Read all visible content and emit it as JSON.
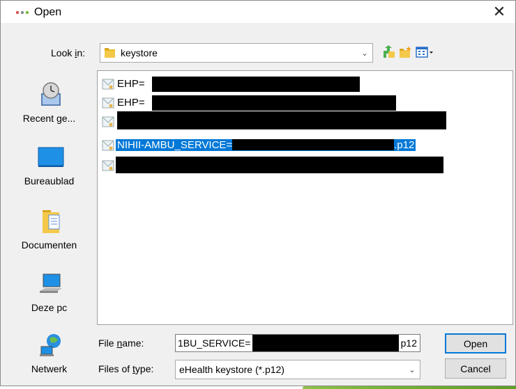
{
  "window": {
    "title": "Open",
    "close_glyph": "✕"
  },
  "lookin": {
    "label_pre": "Look ",
    "label_key": "i",
    "label_post": "n:",
    "value": "keystore"
  },
  "toolbar": {
    "icons": [
      "up-folder-icon",
      "new-folder-icon",
      "view-menu-icon"
    ]
  },
  "places": [
    {
      "label": "Recent ge...",
      "icon": "recent-places-icon"
    },
    {
      "label": "Bureaublad",
      "icon": "desktop-icon"
    },
    {
      "label": "Documenten",
      "icon": "documents-icon"
    },
    {
      "label": "Deze pc",
      "icon": "this-pc-icon"
    },
    {
      "label": "Netwerk",
      "icon": "network-icon"
    }
  ],
  "files": [
    {
      "text": "EHP=",
      "suffix": ""
    },
    {
      "text": "EHP=",
      "suffix": ""
    },
    {
      "text": "",
      "suffix": ""
    },
    {
      "text": "NIHII-AMBU_SERVICE=",
      "suffix": ".p12",
      "selected": true
    },
    {
      "text": "",
      "suffix": ""
    }
  ],
  "filename": {
    "label_pre": "File ",
    "label_key": "n",
    "label_post": "ame:",
    "value_prefix": "1BU_SERVICE=",
    "value_suffix": "p12"
  },
  "filetype": {
    "label_pre": "Files of ",
    "label_key": "t",
    "label_post": "ype:",
    "value": "eHealth keystore (*.p12)"
  },
  "buttons": {
    "open": "Open",
    "cancel": "Cancel"
  },
  "colors": {
    "selection": "#0078d7",
    "accent_green": "#7cb83a"
  }
}
